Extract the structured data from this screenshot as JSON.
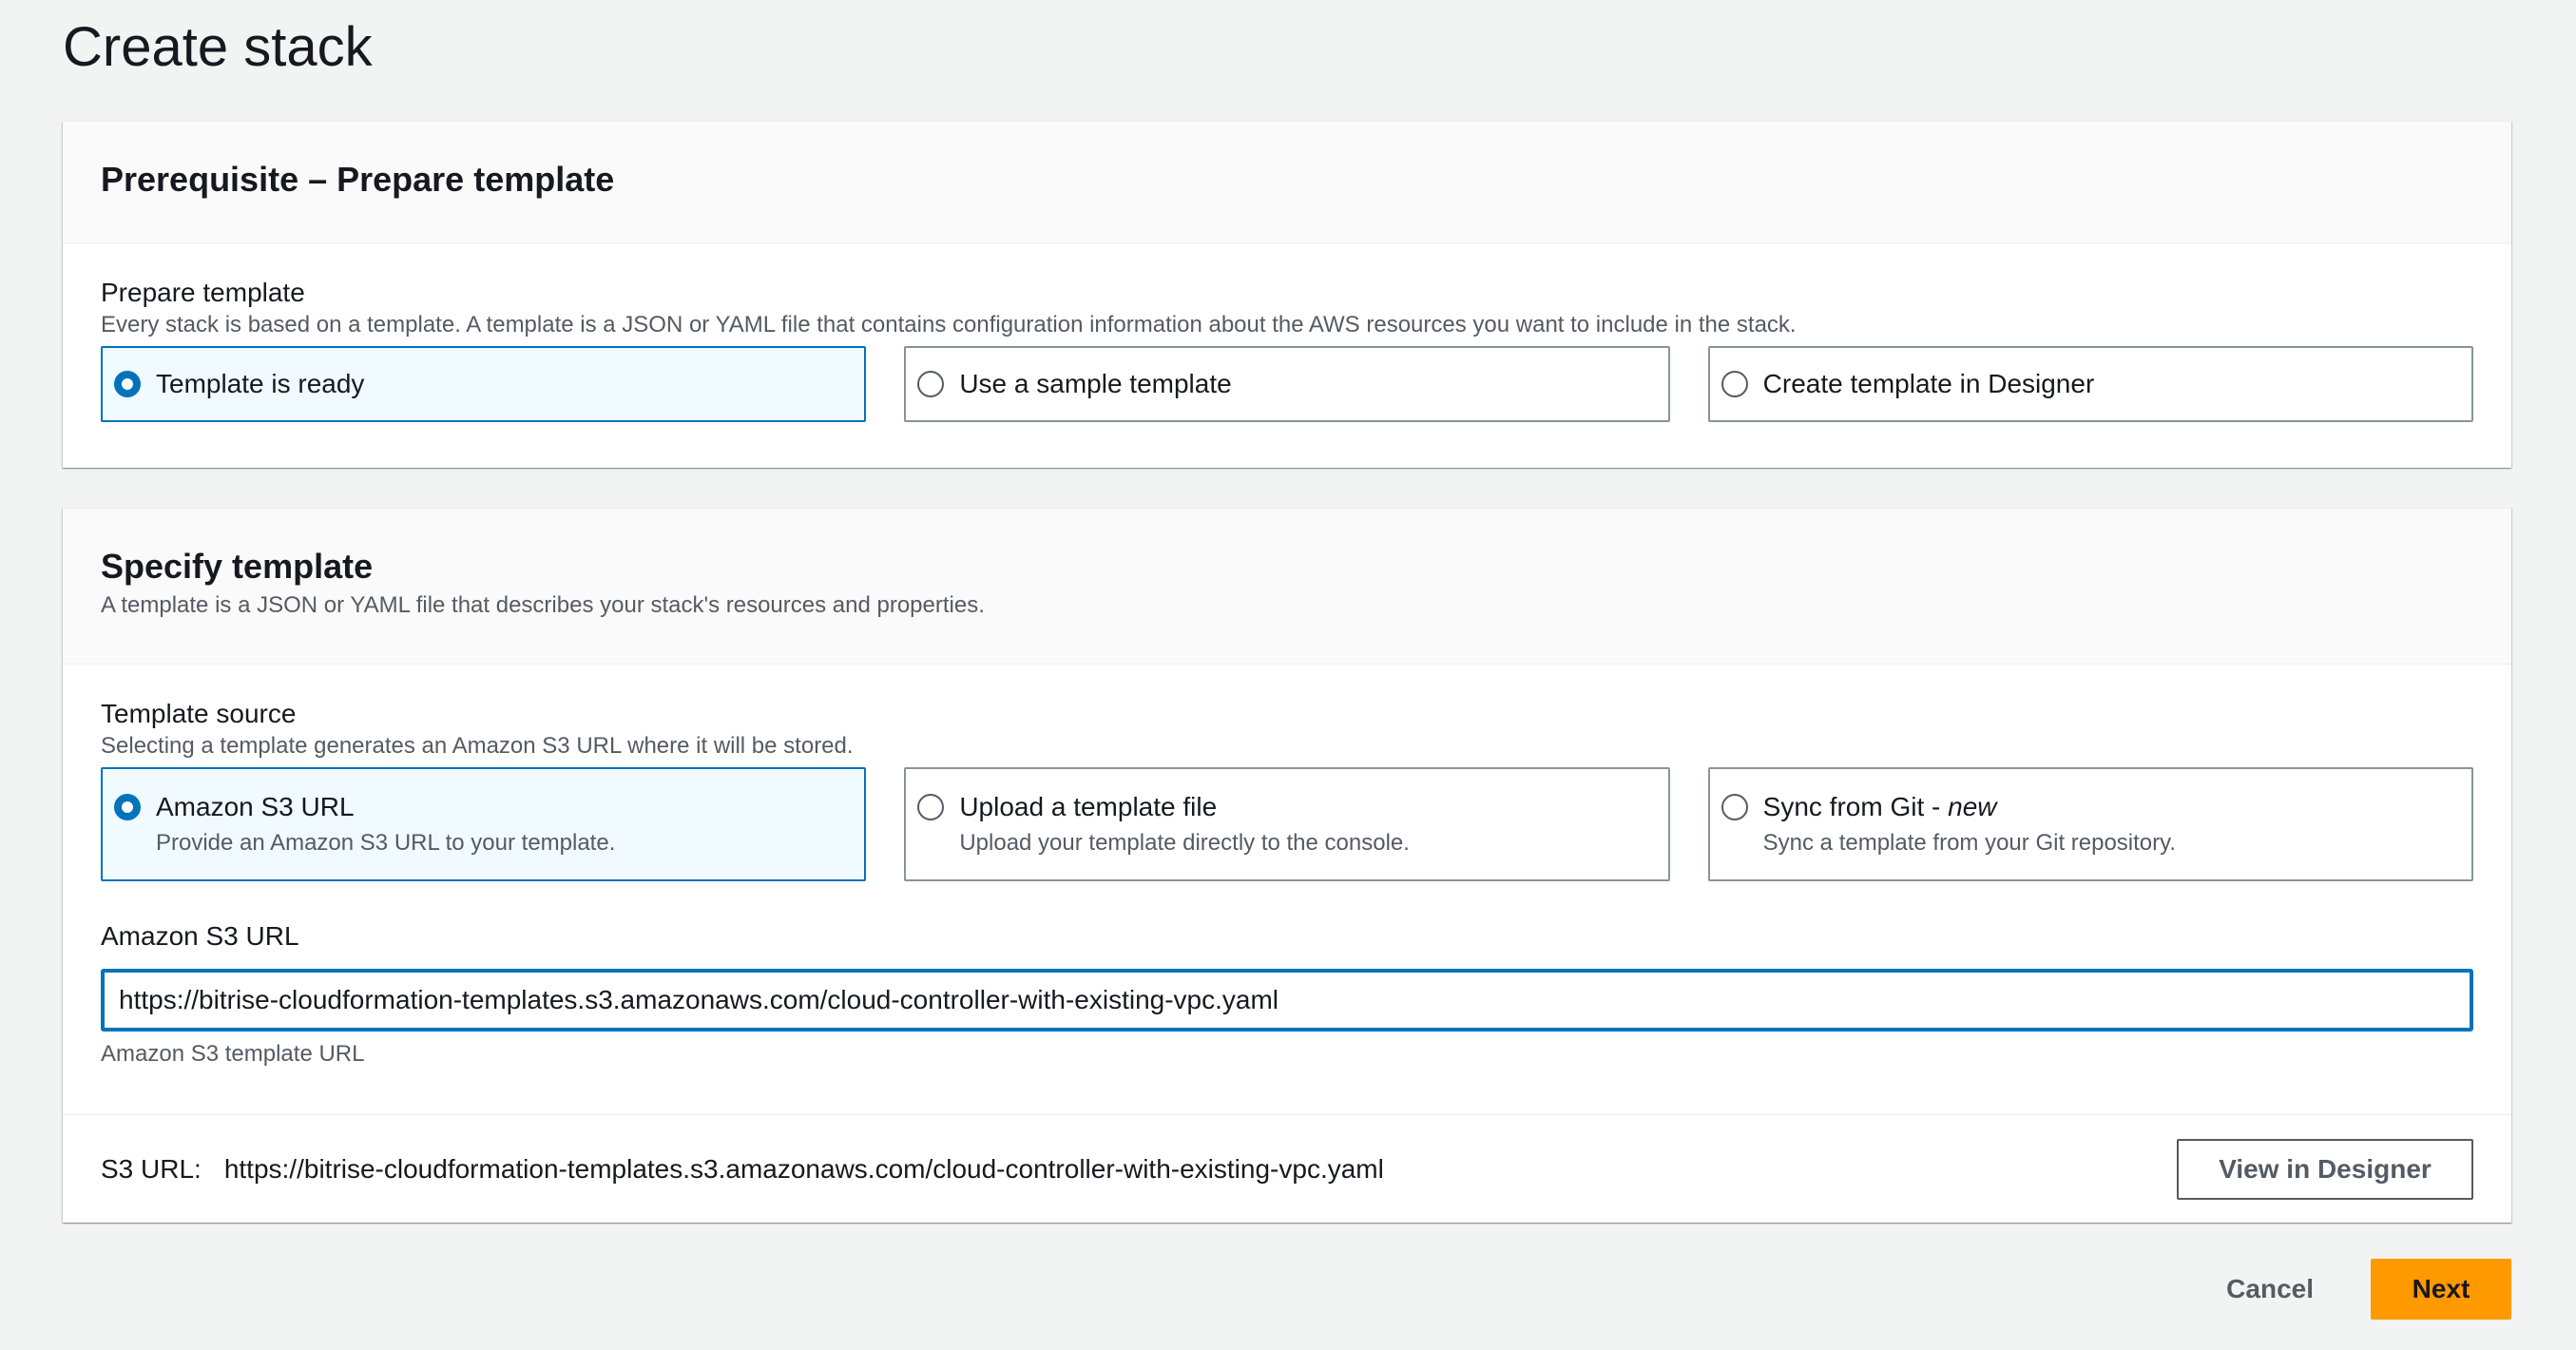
{
  "page": {
    "title": "Create stack"
  },
  "prerequisite": {
    "title": "Prerequisite – Prepare template",
    "field_label": "Prepare template",
    "field_desc": "Every stack is based on a template. A template is a JSON or YAML file that contains configuration information about the AWS resources you want to include in the stack.",
    "options": [
      {
        "label": "Template is ready",
        "selected": true
      },
      {
        "label": "Use a sample template",
        "selected": false
      },
      {
        "label": "Create template in Designer",
        "selected": false
      }
    ]
  },
  "specify": {
    "title": "Specify template",
    "desc": "A template is a JSON or YAML file that describes your stack's resources and properties.",
    "source_label": "Template source",
    "source_desc": "Selecting a template generates an Amazon S3 URL where it will be stored.",
    "sources": [
      {
        "label": "Amazon S3 URL",
        "desc": "Provide an Amazon S3 URL to your template.",
        "selected": true
      },
      {
        "label": "Upload a template file",
        "desc": "Upload your template directly to the console.",
        "selected": false
      },
      {
        "label": "Sync from Git - ",
        "label_em": "new",
        "desc": "Sync a template from your Git repository.",
        "selected": false
      }
    ],
    "url_label": "Amazon S3 URL",
    "url_value": "https://bitrise-cloudformation-templates.s3.amazonaws.com/cloud-controller-with-existing-vpc.yaml",
    "url_hint": "Amazon S3 template URL",
    "footer_label": "S3 URL:",
    "footer_url": "https://bitrise-cloudformation-templates.s3.amazonaws.com/cloud-controller-with-existing-vpc.yaml",
    "view_designer_label": "View in Designer"
  },
  "actions": {
    "cancel_label": "Cancel",
    "next_label": "Next"
  },
  "colors": {
    "accent": "#0073bb",
    "primary_button": "#ff9900",
    "background": "#f2f3f3"
  }
}
